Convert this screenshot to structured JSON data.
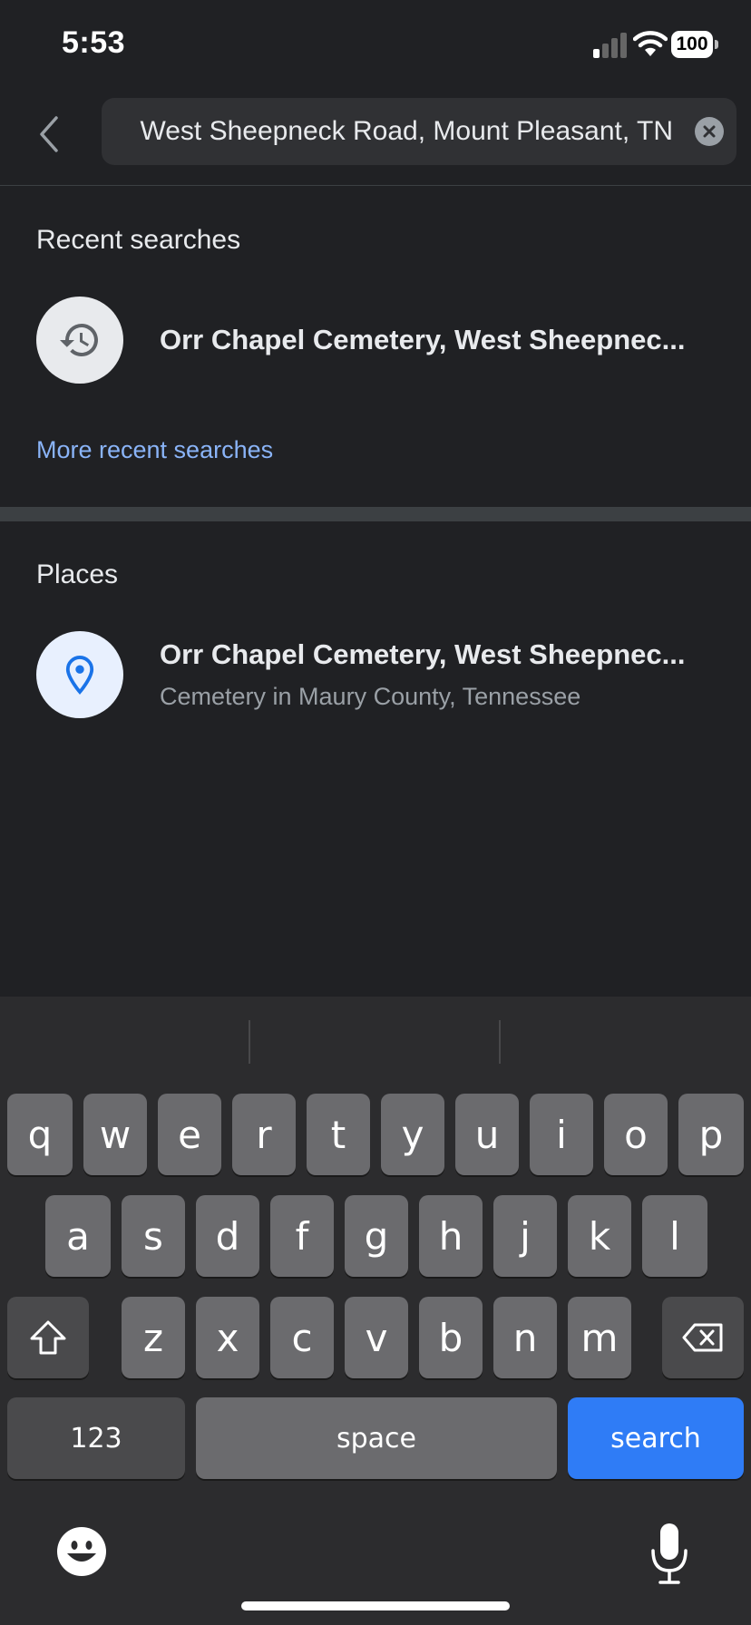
{
  "status_bar": {
    "time": "5:53",
    "battery": "100"
  },
  "search": {
    "query": "West Sheepneck Road, Mount Pleasant, TN"
  },
  "recent": {
    "title": "Recent searches",
    "items": [
      {
        "title": "Orr Chapel Cemetery, West Sheepnec..."
      }
    ],
    "more_label": "More recent searches"
  },
  "places": {
    "title": "Places",
    "items": [
      {
        "title": "Orr Chapel Cemetery, West Sheepnec...",
        "subtitle": "Cemetery in Maury County, Tennessee"
      }
    ]
  },
  "keyboard": {
    "row1": [
      "q",
      "w",
      "e",
      "r",
      "t",
      "y",
      "u",
      "i",
      "o",
      "p"
    ],
    "row2": [
      "a",
      "s",
      "d",
      "f",
      "g",
      "h",
      "j",
      "k",
      "l"
    ],
    "row3": [
      "z",
      "x",
      "c",
      "v",
      "b",
      "n",
      "m"
    ],
    "numbers_label": "123",
    "space_label": "space",
    "search_label": "search"
  },
  "colors": {
    "accent": "#8ab4f8",
    "search_key": "#2f7cf6",
    "pin": "#1a73e8"
  }
}
